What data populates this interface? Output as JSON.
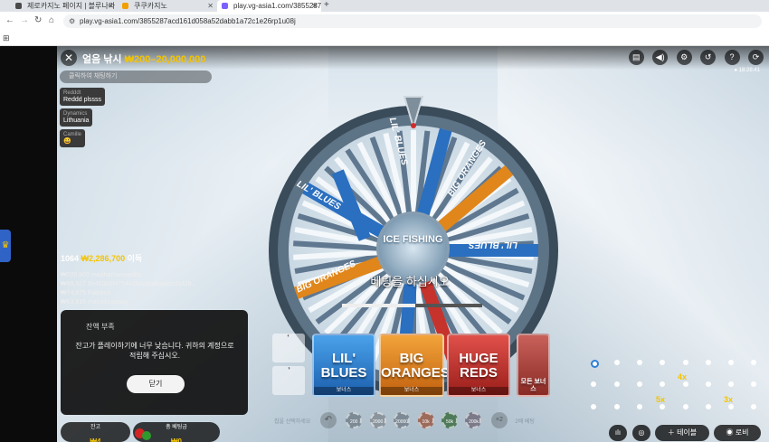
{
  "browser": {
    "tabs": [
      {
        "title": "제로카지노 페이지 | 블루나라",
        "icon_color": "#4a4a4a"
      },
      {
        "title": "쿠쿠카지노",
        "icon_color": "#f0a000"
      },
      {
        "title": "play.vg-asia1.com/3855287",
        "icon_color": "#7b61ff"
      }
    ],
    "new_tab_icon": "plus-icon",
    "url": "play.vg-asia1.com/3855287acd161d058a52dabb1a72c1e26rp1u08j"
  },
  "game": {
    "title": "얼음 낚시",
    "limits": "₩200–20,000,000",
    "chat_placeholder": "클릭하여 채팅하기",
    "chat_messages": [
      {
        "user": "Redddt",
        "text": "Reddd plssss"
      },
      {
        "user": "Dynamics",
        "text": "Lithuania"
      },
      {
        "user": "Camille",
        "text": "😀"
      }
    ],
    "clock": "● 18:28:41",
    "wheel_center": "ICE FISHING",
    "bet_prompt": "베팅을 하십시오",
    "timer_progress": 0.52,
    "winners": {
      "count": "1064",
      "amount": "₩2,286,700",
      "suffix": "이득",
      "rows": [
        "₩200,809 madhathamsedha",
        "₩99,527 8e41002f47544384abb6baddcd3d2b...",
        "₩74,675 Fabiano",
        "₩63,816 mainebrapday"
      ]
    },
    "dialog": {
      "title": "잔액 부족",
      "body": "잔고가 플레이하기에 너무 낮습니다. 귀하의 계정으로 적립해 주십시오.",
      "button": "닫기"
    },
    "balance": {
      "label": "잔고",
      "value": "₩4"
    },
    "total_bet": {
      "label": "총 베팅금",
      "value": "₩0"
    },
    "bet_spots": [
      {
        "name": "LIL' BLUES",
        "sub": "보너스",
        "color": "#2a86d8"
      },
      {
        "name": "BIG ORANGES",
        "sub": "보너스",
        "color": "#e08a1c"
      },
      {
        "name": "HUGE REDS",
        "sub": "보너스",
        "color": "#c8302a"
      },
      {
        "name": "모든 보너스",
        "sub": "",
        "color": "#b54a3a"
      }
    ],
    "chips_label": "칩을 선택하세요",
    "chips": [
      {
        "label": "200",
        "color": "#7c8a95"
      },
      {
        "label": "2000",
        "color": "#8a949c"
      },
      {
        "label": "20000",
        "color": "#7c8a95"
      },
      {
        "label": "10k",
        "color": "#9c6b5c"
      },
      {
        "label": "50k",
        "color": "#4f7a5a"
      },
      {
        "label": "200k",
        "color": "#7a7a8a"
      }
    ],
    "double_label": "×2",
    "repeat_label": "2배 베팅",
    "multipliers": [
      "4x",
      "5x",
      "3x"
    ],
    "lobby_label": "로비",
    "table_label": "테이블",
    "top_icons": [
      "chat-icon",
      "volume-icon",
      "settings-icon",
      "history-icon",
      "help-icon",
      "refresh-icon"
    ]
  }
}
